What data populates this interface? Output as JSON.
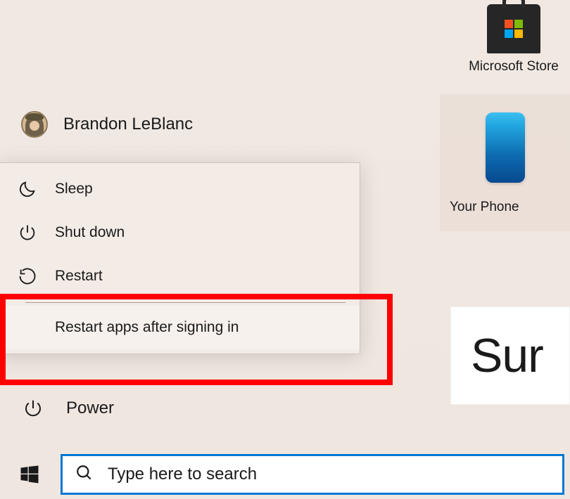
{
  "user": {
    "name": "Brandon LeBlanc"
  },
  "power_menu": {
    "sleep": "Sleep",
    "shutdown": "Shut down",
    "restart": "Restart",
    "restart_apps": "Restart apps after signing in"
  },
  "power_label": "Power",
  "search": {
    "placeholder": "Type here to search"
  },
  "tiles": {
    "store_label": "Microsoft Store",
    "phone_label": "Your Phone",
    "surface_text": "Sur"
  }
}
